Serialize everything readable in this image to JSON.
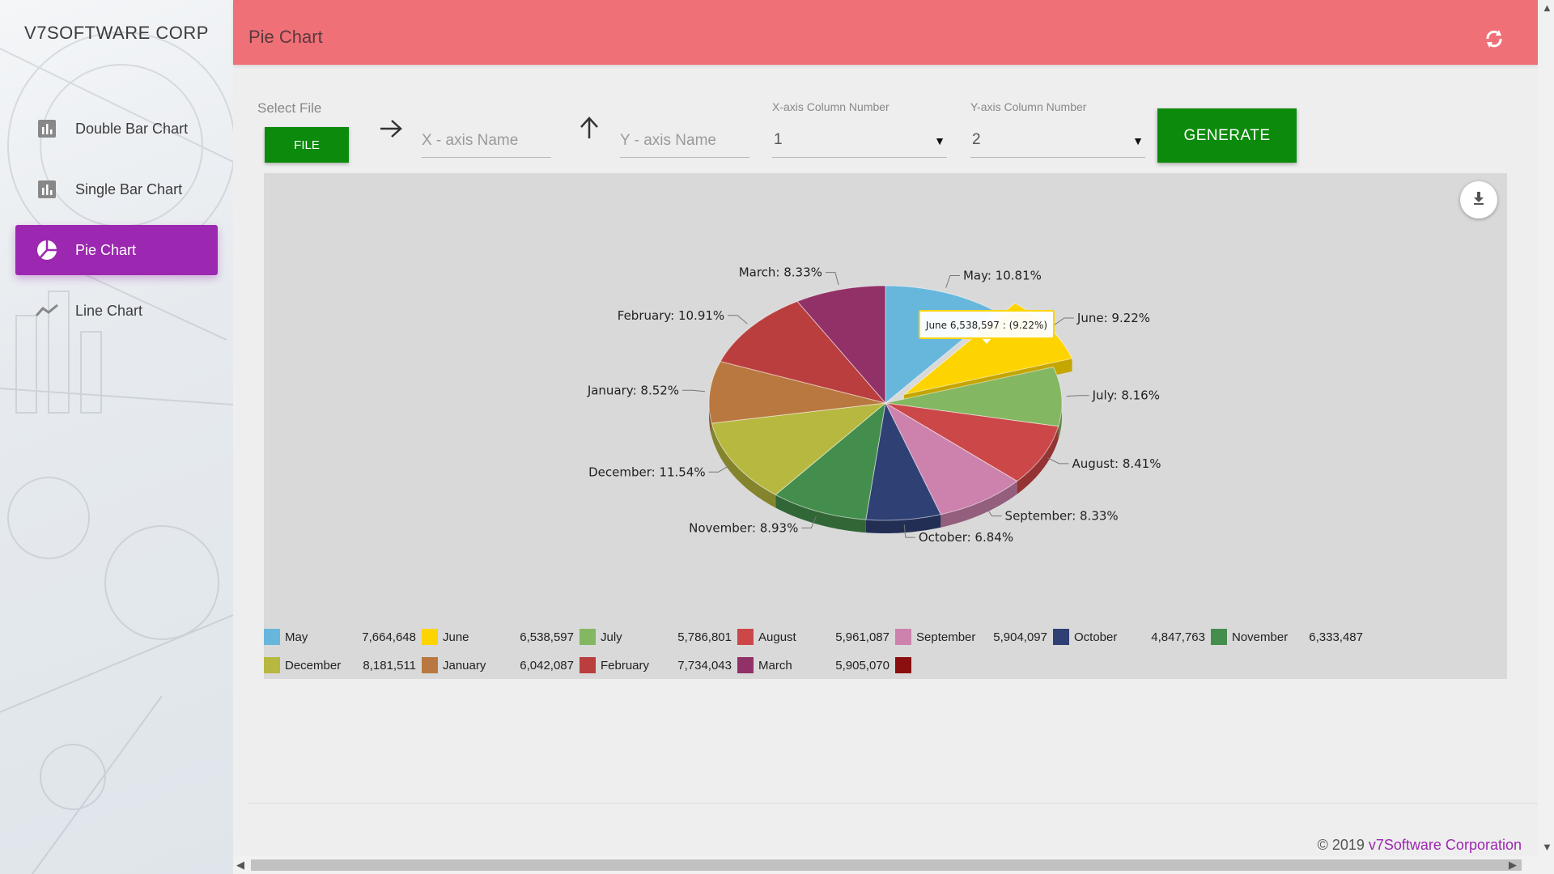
{
  "sidebar": {
    "brand": "V7SOFTWARE CORP",
    "items": [
      {
        "label": "Double Bar Chart",
        "icon": "bar-chart-icon",
        "active": false
      },
      {
        "label": "Single Bar Chart",
        "icon": "bar-chart-icon",
        "active": false
      },
      {
        "label": "Pie Chart",
        "icon": "pie-chart-icon",
        "active": true
      },
      {
        "label": "Line Chart",
        "icon": "line-chart-icon",
        "active": false
      }
    ]
  },
  "header": {
    "title": "Pie Chart",
    "refresh_icon": "refresh-icon"
  },
  "controls": {
    "select_file_label": "Select File",
    "file_button": "FILE",
    "x_axis_placeholder": "X - axis Name",
    "y_axis_placeholder": "Y - axis Name",
    "x_col_label": "X-axis Column Number",
    "x_col_value": "1",
    "y_col_label": "Y-axis Column Number",
    "y_col_value": "2",
    "generate_button": "GENERATE"
  },
  "footer": {
    "copyright": "© 2019 ",
    "company": "v7Software Corporation"
  },
  "tooltip": "June 6,538,597 : (9.22%)",
  "chart_data": {
    "type": "pie",
    "style": "3d",
    "exploded": "June",
    "categories": [
      "May",
      "June",
      "July",
      "August",
      "September",
      "October",
      "November",
      "December",
      "January",
      "February",
      "March"
    ],
    "values": [
      7664648,
      6538597,
      5786801,
      5961087,
      5904097,
      4847763,
      6333487,
      8181511,
      6042087,
      7734043,
      5905070
    ],
    "value_labels": [
      "7,664,648",
      "6,538,597",
      "5,786,801",
      "5,961,087",
      "5,904,097",
      "4,847,763",
      "6,333,487",
      "8,181,511",
      "6,042,087",
      "7,734,043",
      "5,905,070"
    ],
    "percent_labels": [
      "May: 10.81%",
      "June: 9.22%",
      "July: 8.16%",
      "August: 8.41%",
      "September: 8.33%",
      "October: 6.84%",
      "November: 8.93%",
      "December: 11.54%",
      "January: 8.52%",
      "February: 10.91%",
      "March: 8.33%"
    ],
    "colors": [
      "#67b7dc",
      "#fdd400",
      "#84b761",
      "#cc4748",
      "#cd82ad",
      "#2f4074",
      "#448e4d",
      "#b7b83f",
      "#b9783f",
      "#b93e3d",
      "#913167"
    ],
    "extra_legend": {
      "name": "",
      "value": "NaN",
      "color": "#8b0f0f"
    }
  }
}
